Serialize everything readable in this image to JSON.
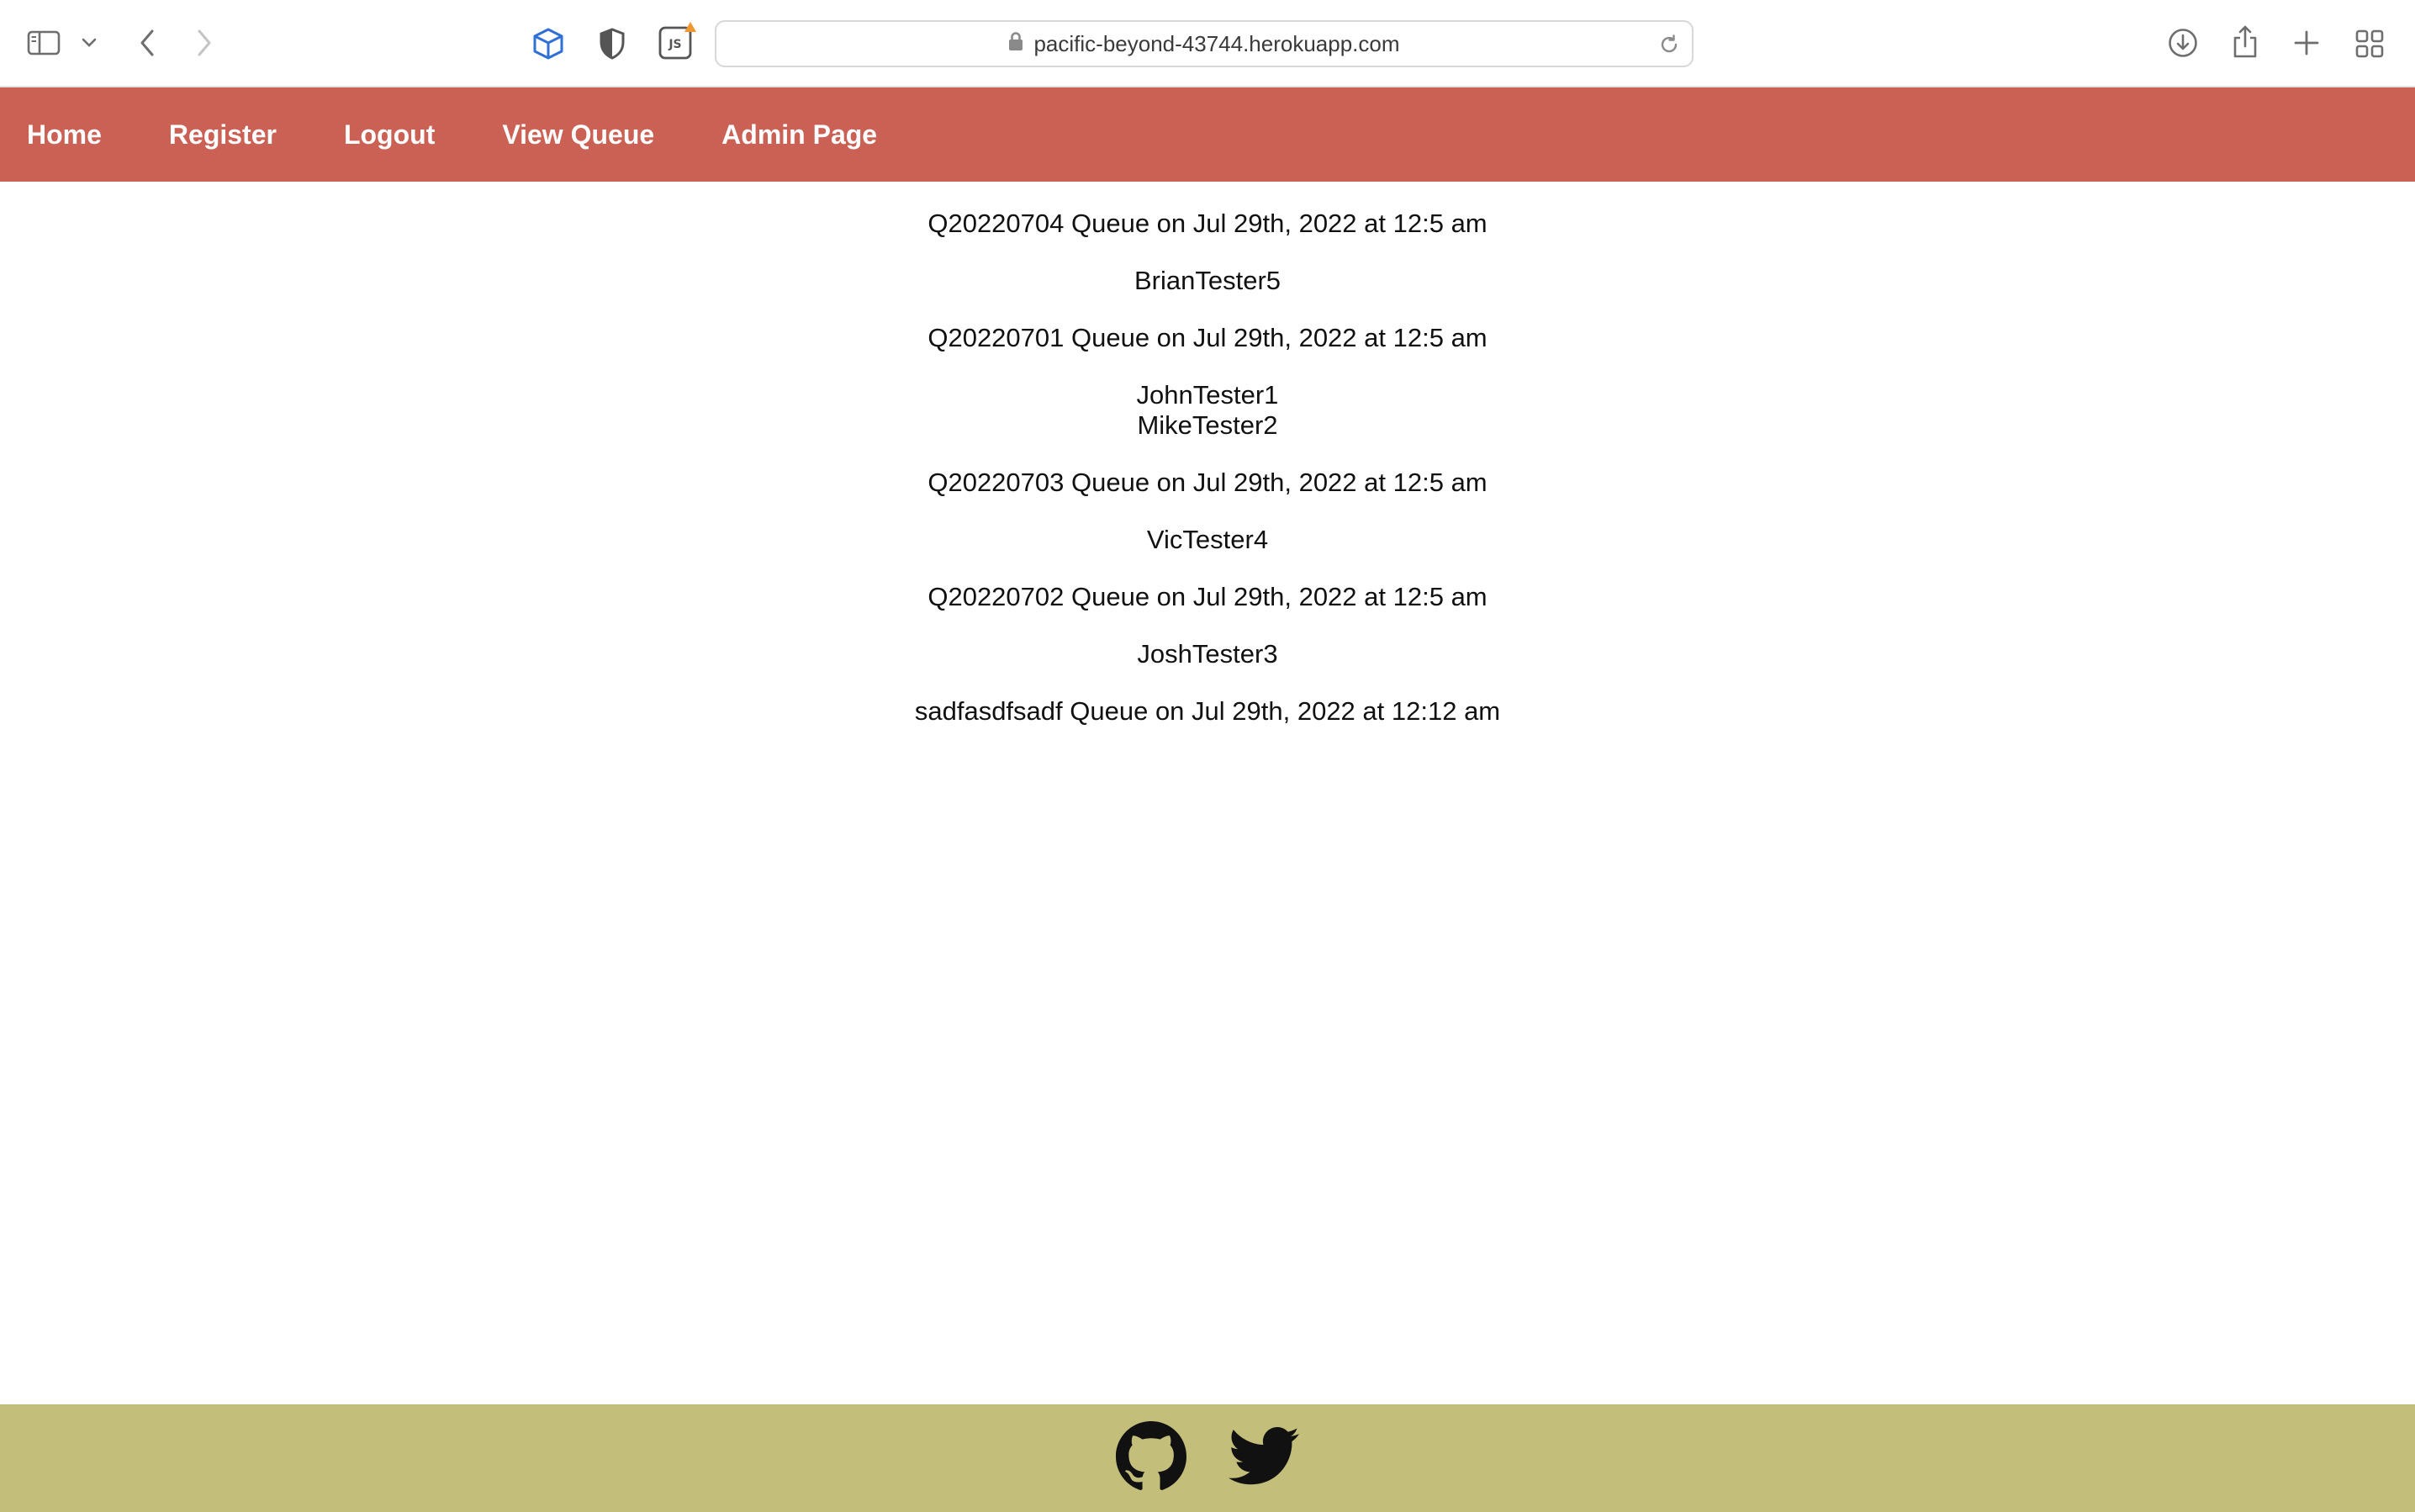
{
  "browser": {
    "url": "pacific-beyond-43744.herokuapp.com",
    "icons": [
      "sidebar-icon",
      "chevron-down-icon",
      "back-icon",
      "forward-icon",
      "extension-cube-icon",
      "shield-icon",
      "js-extension-icon",
      "lock-icon",
      "reload-icon",
      "download-icon",
      "share-icon",
      "new-tab-icon",
      "tab-overview-icon"
    ]
  },
  "nav": {
    "home": "Home",
    "register": "Register",
    "logout": "Logout",
    "view_queue": "View Queue",
    "admin_page": "Admin Page"
  },
  "queues": [
    {
      "title": "Q20220704 Queue on Jul 29th, 2022 at 12:5 am",
      "members": [
        "BrianTester5"
      ]
    },
    {
      "title": "Q20220701 Queue on Jul 29th, 2022 at 12:5 am",
      "members": [
        "JohnTester1",
        "MikeTester2"
      ]
    },
    {
      "title": "Q20220703 Queue on Jul 29th, 2022 at 12:5 am",
      "members": [
        "VicTester4"
      ]
    },
    {
      "title": "Q20220702 Queue on Jul 29th, 2022 at 12:5 am",
      "members": [
        "JoshTester3"
      ]
    },
    {
      "title": "sadfasdfsadf Queue on Jul 29th, 2022 at 12:12 am",
      "members": []
    }
  ],
  "footer": {
    "icons": [
      "github-icon",
      "twitter-icon"
    ]
  },
  "colors": {
    "nav_background": "#cb6155",
    "footer_background": "#c3bf7b",
    "nav_text": "#ffffff"
  }
}
